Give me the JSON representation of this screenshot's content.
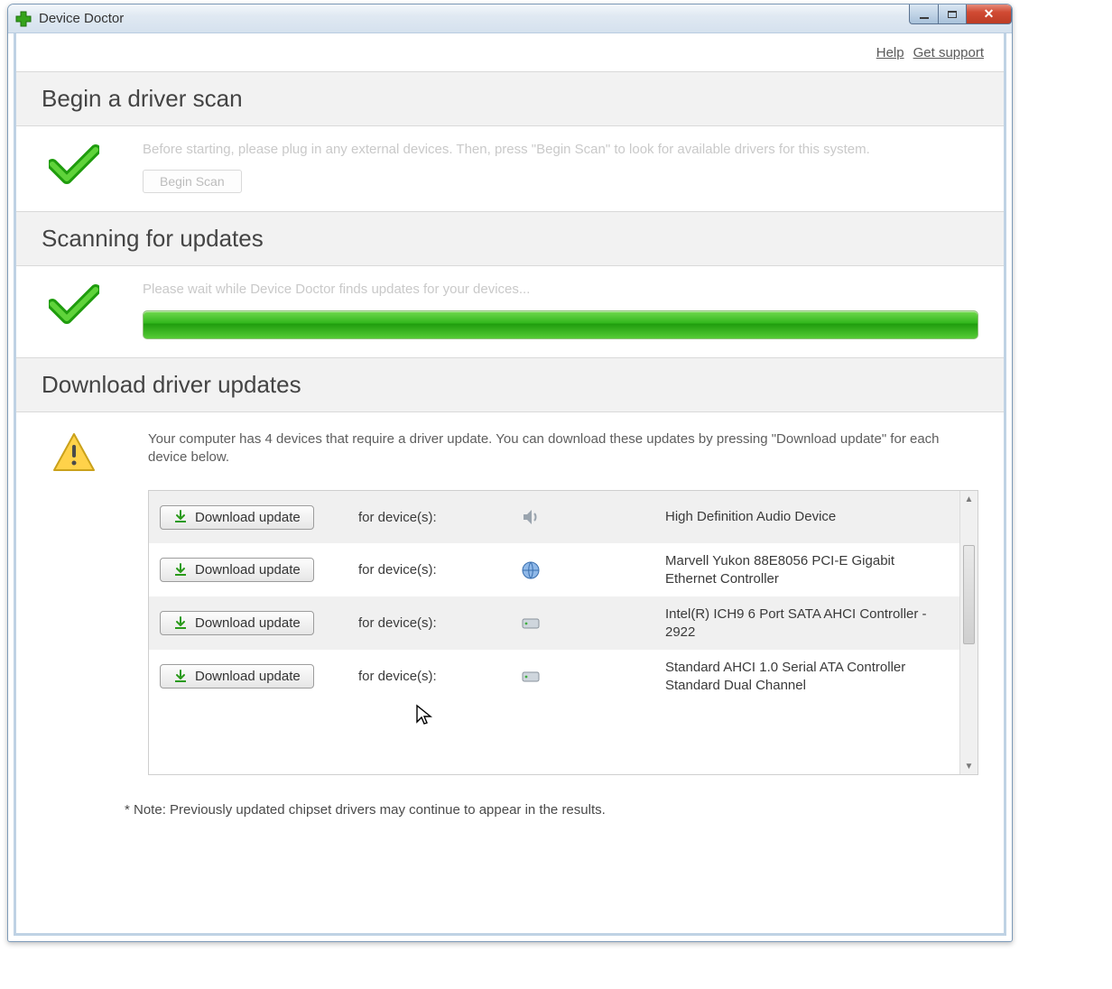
{
  "window": {
    "title": "Device Doctor"
  },
  "help": {
    "help": "Help",
    "support": "Get support"
  },
  "sections": {
    "begin": {
      "heading": "Begin a driver scan",
      "text": "Before starting, please plug in any external devices. Then, press \"Begin Scan\" to look for available drivers for this system.",
      "button": "Begin Scan"
    },
    "scan": {
      "heading": "Scanning for updates",
      "text": "Please wait while Device Doctor finds updates for your devices..."
    },
    "download": {
      "heading": "Download driver updates",
      "text": "Your computer has 4 devices that require a driver update. You can download these updates by pressing \"Download update\" for each device below.",
      "for_label": "for device(s):",
      "button": "Download update",
      "note": "* Note: Previously updated chipset drivers may continue to appear in the results."
    }
  },
  "devices": [
    {
      "name": "High Definition Audio Device",
      "icon": "audio"
    },
    {
      "name": "Marvell Yukon 88E8056 PCI-E Gigabit Ethernet Controller",
      "icon": "network"
    },
    {
      "name": "Intel(R) ICH9 6 Port SATA AHCI Controller - 2922",
      "icon": "storage"
    },
    {
      "name": "Standard AHCI 1.0 Serial ATA Controller\nStandard Dual Channel",
      "icon": "storage"
    }
  ]
}
